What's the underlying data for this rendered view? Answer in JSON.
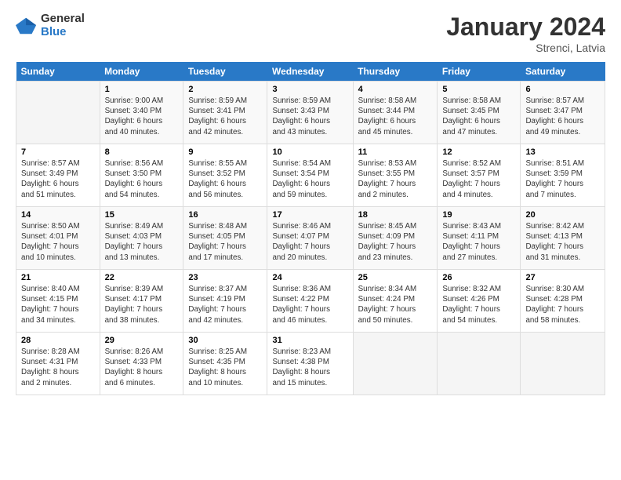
{
  "logo": {
    "general": "General",
    "blue": "Blue"
  },
  "title": "January 2024",
  "subtitle": "Strenci, Latvia",
  "header_days": [
    "Sunday",
    "Monday",
    "Tuesday",
    "Wednesday",
    "Thursday",
    "Friday",
    "Saturday"
  ],
  "weeks": [
    [
      {
        "num": "",
        "info": ""
      },
      {
        "num": "1",
        "info": "Sunrise: 9:00 AM\nSunset: 3:40 PM\nDaylight: 6 hours\nand 40 minutes."
      },
      {
        "num": "2",
        "info": "Sunrise: 8:59 AM\nSunset: 3:41 PM\nDaylight: 6 hours\nand 42 minutes."
      },
      {
        "num": "3",
        "info": "Sunrise: 8:59 AM\nSunset: 3:43 PM\nDaylight: 6 hours\nand 43 minutes."
      },
      {
        "num": "4",
        "info": "Sunrise: 8:58 AM\nSunset: 3:44 PM\nDaylight: 6 hours\nand 45 minutes."
      },
      {
        "num": "5",
        "info": "Sunrise: 8:58 AM\nSunset: 3:45 PM\nDaylight: 6 hours\nand 47 minutes."
      },
      {
        "num": "6",
        "info": "Sunrise: 8:57 AM\nSunset: 3:47 PM\nDaylight: 6 hours\nand 49 minutes."
      }
    ],
    [
      {
        "num": "7",
        "info": "Sunrise: 8:57 AM\nSunset: 3:49 PM\nDaylight: 6 hours\nand 51 minutes."
      },
      {
        "num": "8",
        "info": "Sunrise: 8:56 AM\nSunset: 3:50 PM\nDaylight: 6 hours\nand 54 minutes."
      },
      {
        "num": "9",
        "info": "Sunrise: 8:55 AM\nSunset: 3:52 PM\nDaylight: 6 hours\nand 56 minutes."
      },
      {
        "num": "10",
        "info": "Sunrise: 8:54 AM\nSunset: 3:54 PM\nDaylight: 6 hours\nand 59 minutes."
      },
      {
        "num": "11",
        "info": "Sunrise: 8:53 AM\nSunset: 3:55 PM\nDaylight: 7 hours\nand 2 minutes."
      },
      {
        "num": "12",
        "info": "Sunrise: 8:52 AM\nSunset: 3:57 PM\nDaylight: 7 hours\nand 4 minutes."
      },
      {
        "num": "13",
        "info": "Sunrise: 8:51 AM\nSunset: 3:59 PM\nDaylight: 7 hours\nand 7 minutes."
      }
    ],
    [
      {
        "num": "14",
        "info": "Sunrise: 8:50 AM\nSunset: 4:01 PM\nDaylight: 7 hours\nand 10 minutes."
      },
      {
        "num": "15",
        "info": "Sunrise: 8:49 AM\nSunset: 4:03 PM\nDaylight: 7 hours\nand 13 minutes."
      },
      {
        "num": "16",
        "info": "Sunrise: 8:48 AM\nSunset: 4:05 PM\nDaylight: 7 hours\nand 17 minutes."
      },
      {
        "num": "17",
        "info": "Sunrise: 8:46 AM\nSunset: 4:07 PM\nDaylight: 7 hours\nand 20 minutes."
      },
      {
        "num": "18",
        "info": "Sunrise: 8:45 AM\nSunset: 4:09 PM\nDaylight: 7 hours\nand 23 minutes."
      },
      {
        "num": "19",
        "info": "Sunrise: 8:43 AM\nSunset: 4:11 PM\nDaylight: 7 hours\nand 27 minutes."
      },
      {
        "num": "20",
        "info": "Sunrise: 8:42 AM\nSunset: 4:13 PM\nDaylight: 7 hours\nand 31 minutes."
      }
    ],
    [
      {
        "num": "21",
        "info": "Sunrise: 8:40 AM\nSunset: 4:15 PM\nDaylight: 7 hours\nand 34 minutes."
      },
      {
        "num": "22",
        "info": "Sunrise: 8:39 AM\nSunset: 4:17 PM\nDaylight: 7 hours\nand 38 minutes."
      },
      {
        "num": "23",
        "info": "Sunrise: 8:37 AM\nSunset: 4:19 PM\nDaylight: 7 hours\nand 42 minutes."
      },
      {
        "num": "24",
        "info": "Sunrise: 8:36 AM\nSunset: 4:22 PM\nDaylight: 7 hours\nand 46 minutes."
      },
      {
        "num": "25",
        "info": "Sunrise: 8:34 AM\nSunset: 4:24 PM\nDaylight: 7 hours\nand 50 minutes."
      },
      {
        "num": "26",
        "info": "Sunrise: 8:32 AM\nSunset: 4:26 PM\nDaylight: 7 hours\nand 54 minutes."
      },
      {
        "num": "27",
        "info": "Sunrise: 8:30 AM\nSunset: 4:28 PM\nDaylight: 7 hours\nand 58 minutes."
      }
    ],
    [
      {
        "num": "28",
        "info": "Sunrise: 8:28 AM\nSunset: 4:31 PM\nDaylight: 8 hours\nand 2 minutes."
      },
      {
        "num": "29",
        "info": "Sunrise: 8:26 AM\nSunset: 4:33 PM\nDaylight: 8 hours\nand 6 minutes."
      },
      {
        "num": "30",
        "info": "Sunrise: 8:25 AM\nSunset: 4:35 PM\nDaylight: 8 hours\nand 10 minutes."
      },
      {
        "num": "31",
        "info": "Sunrise: 8:23 AM\nSunset: 4:38 PM\nDaylight: 8 hours\nand 15 minutes."
      },
      {
        "num": "",
        "info": ""
      },
      {
        "num": "",
        "info": ""
      },
      {
        "num": "",
        "info": ""
      }
    ]
  ]
}
